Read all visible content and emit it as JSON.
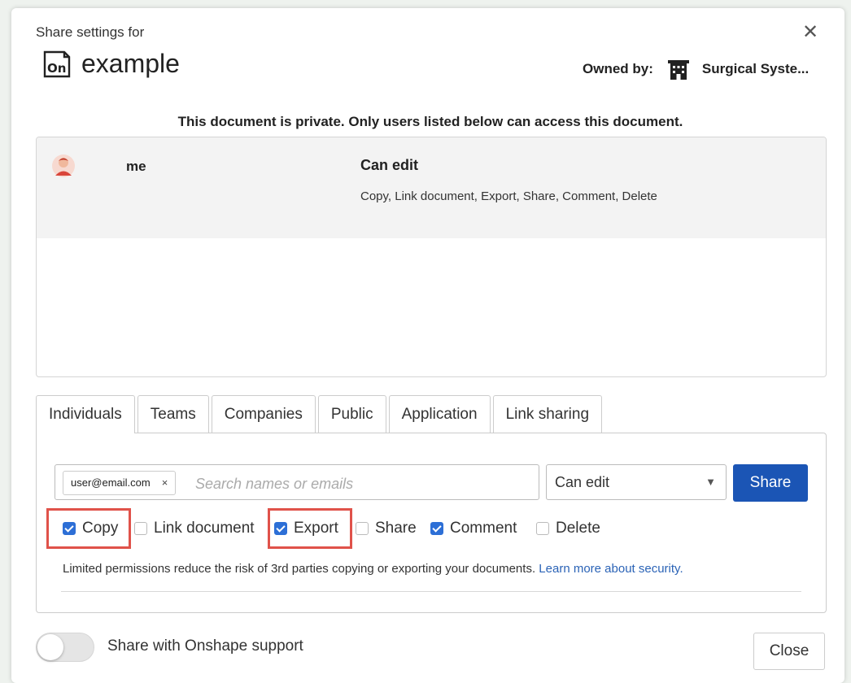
{
  "dialog": {
    "header_label": "Share settings for",
    "close_glyph": "✕",
    "document_title": "example",
    "app_icon_name": "onshape-icon",
    "owner_label": "Owned by:",
    "owner_name": "Surgical Syste...",
    "owner_icon_name": "building-icon",
    "privacy_note": "This document is private. Only users listed below can access this document."
  },
  "users": [
    {
      "name": "me",
      "permission": "Can edit",
      "permission_detail": "Copy, Link document, Export, Share, Comment, Delete"
    }
  ],
  "tabs": [
    {
      "label": "Individuals",
      "active": true
    },
    {
      "label": "Teams",
      "active": false
    },
    {
      "label": "Companies",
      "active": false
    },
    {
      "label": "Public",
      "active": false
    },
    {
      "label": "Application",
      "active": false
    },
    {
      "label": "Link sharing",
      "active": false
    }
  ],
  "invite": {
    "chip_email": "user@email.com",
    "chip_remove": "×",
    "search_placeholder": "Search names or emails",
    "permission_value": "Can edit",
    "caret": "▼",
    "share_label": "Share"
  },
  "checkboxes": [
    {
      "label": "Copy",
      "checked": true,
      "highlighted": true
    },
    {
      "label": "Link document",
      "checked": false,
      "highlighted": false
    },
    {
      "label": "Export",
      "checked": true,
      "highlighted": true
    },
    {
      "label": "Share",
      "checked": false,
      "highlighted": false
    },
    {
      "label": "Comment",
      "checked": true,
      "highlighted": false
    },
    {
      "label": "Delete",
      "checked": false,
      "highlighted": false
    }
  ],
  "limited_note": "Limited permissions reduce the risk of 3rd parties copying or exporting your documents.",
  "learn_more": "Learn more about security.",
  "footer": {
    "toggle_label": "Share with Onshape support",
    "toggle_on": false,
    "close_label": "Close"
  },
  "colors": {
    "primary": "#1b55b5",
    "checkbox": "#2d6fd6",
    "highlight": "#e0524a",
    "link": "#2b63b6"
  }
}
